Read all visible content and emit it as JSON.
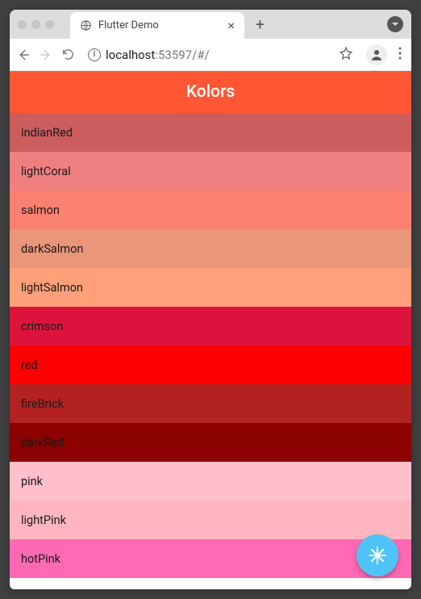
{
  "browser": {
    "tab_title": "Flutter Demo",
    "url_host": "localhost",
    "url_path": ":53597/#/"
  },
  "app": {
    "title": "Kolors",
    "appbar_color": "#ff5733",
    "fab_color": "#4fc3f7"
  },
  "colors": [
    {
      "name": "indianRed",
      "hex": "#cd5c5c"
    },
    {
      "name": "lightCoral",
      "hex": "#f08080"
    },
    {
      "name": "salmon",
      "hex": "#fa8072"
    },
    {
      "name": "darkSalmon",
      "hex": "#e9967a"
    },
    {
      "name": "lightSalmon",
      "hex": "#ffa07a"
    },
    {
      "name": "crimson",
      "hex": "#dc143c"
    },
    {
      "name": "red",
      "hex": "#ff0000"
    },
    {
      "name": "fireBrick",
      "hex": "#b22222"
    },
    {
      "name": "darkRed",
      "hex": "#8b0000"
    },
    {
      "name": "pink",
      "hex": "#ffc0cb"
    },
    {
      "name": "lightPink",
      "hex": "#ffb6c1"
    },
    {
      "name": "hotPink",
      "hex": "#ff69b4"
    }
  ]
}
